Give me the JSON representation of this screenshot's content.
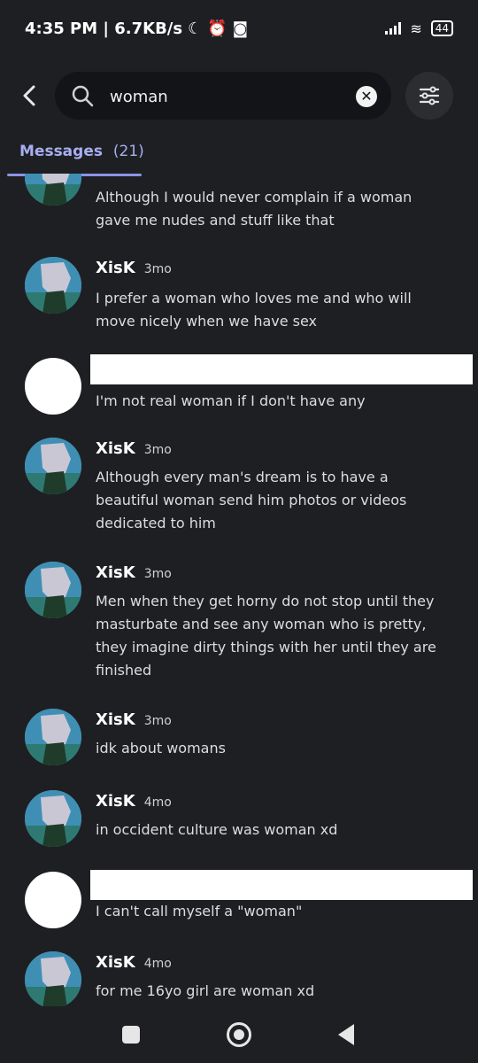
{
  "status_bar": {
    "time_speed": "4:35 PM | 6.7KB/s",
    "battery": "44",
    "icons": [
      "moon-icon",
      "alarm-icon",
      "discord-icon",
      "signal-icon",
      "wifi-icon",
      "battery-icon"
    ]
  },
  "search": {
    "query": "woman",
    "icons": [
      "back-arrow-icon",
      "search-icon",
      "clear-icon",
      "filter-icon"
    ]
  },
  "tabs": [
    {
      "label": "Messages",
      "count": "(21)",
      "active": true
    }
  ],
  "messages": [
    {
      "author": "",
      "time": "",
      "avatar": "anime",
      "text": "Although I would never complain if a woman gave me nudes and stuff like that"
    },
    {
      "author": "XisK",
      "time": "3mo",
      "avatar": "anime",
      "text": "I prefer a woman who loves me and who will move nicely when we have sex"
    },
    {
      "author": "",
      "time": "",
      "avatar": "blank",
      "text": "I'm not real woman if I don't have any"
    },
    {
      "author": "XisK",
      "time": "3mo",
      "avatar": "anime",
      "text": "Although every man's dream is to have a beautiful woman send him photos or videos dedicated to him"
    },
    {
      "author": "XisK",
      "time": "3mo",
      "avatar": "anime",
      "text": "Men when they get horny do not stop until they masturbate and see any woman who is pretty, they imagine dirty things with her until they are finished"
    },
    {
      "author": "XisK",
      "time": "3mo",
      "avatar": "anime",
      "text": "idk about womans"
    },
    {
      "author": "XisK",
      "time": "4mo",
      "avatar": "anime",
      "text": "in occident culture was woman xd"
    },
    {
      "author": "",
      "time": "",
      "avatar": "blank",
      "text": "I can't call myself a \"woman\""
    },
    {
      "author": "XisK",
      "time": "4mo",
      "avatar": "anime",
      "text": "for me 16yo girl are woman xd"
    }
  ],
  "nav": [
    "recent-apps-button",
    "home-button",
    "back-button"
  ]
}
